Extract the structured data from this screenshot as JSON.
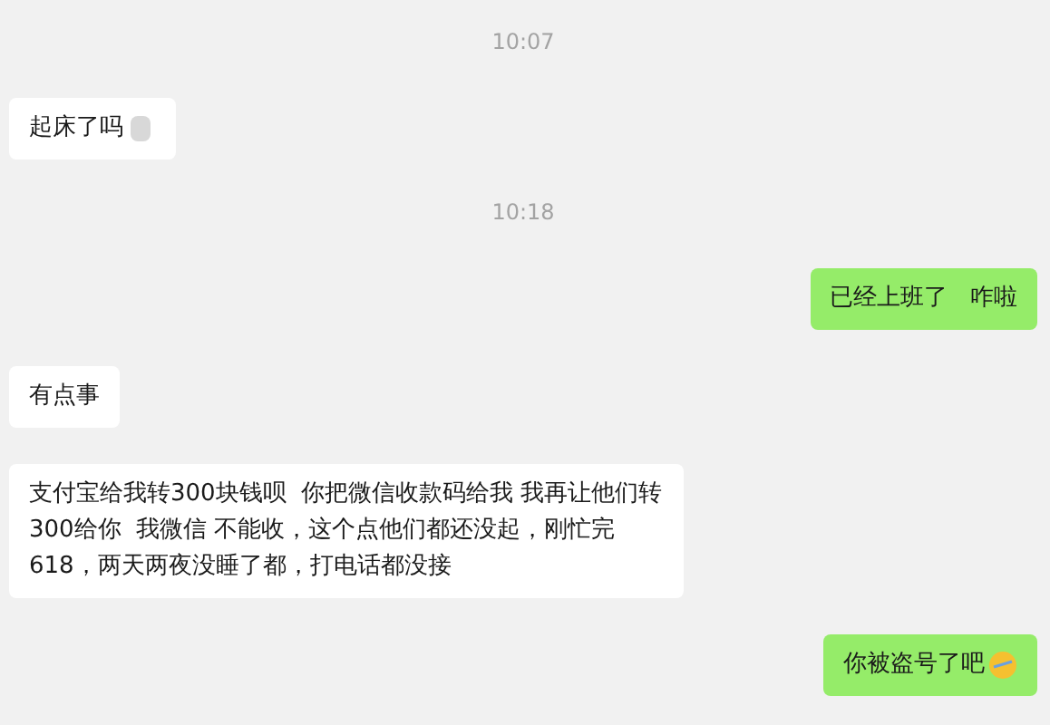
{
  "messages": [
    {
      "kind": "time",
      "text": "10:07"
    },
    {
      "kind": "message",
      "sent": false,
      "text": "起床了吗",
      "emoji": true
    },
    {
      "kind": "time",
      "text": "10:18"
    },
    {
      "kind": "message",
      "sent": true,
      "text": "已经上班了   咋啦",
      "emoji": false
    },
    {
      "kind": "message",
      "sent": false,
      "text": "有点事",
      "emoji": false
    },
    {
      "kind": "message",
      "sent": false,
      "text": "支付宝给我转300块钱呗  你把微信收款码给我 我再让他们转300给你  我微信 不能收，这个点他们都还没起，刚忙完618，两天两夜没睡了都，打电话都没接",
      "emoji": false
    },
    {
      "kind": "message",
      "sent": true,
      "text": "你被盗号了吧",
      "emoji": true
    }
  ]
}
